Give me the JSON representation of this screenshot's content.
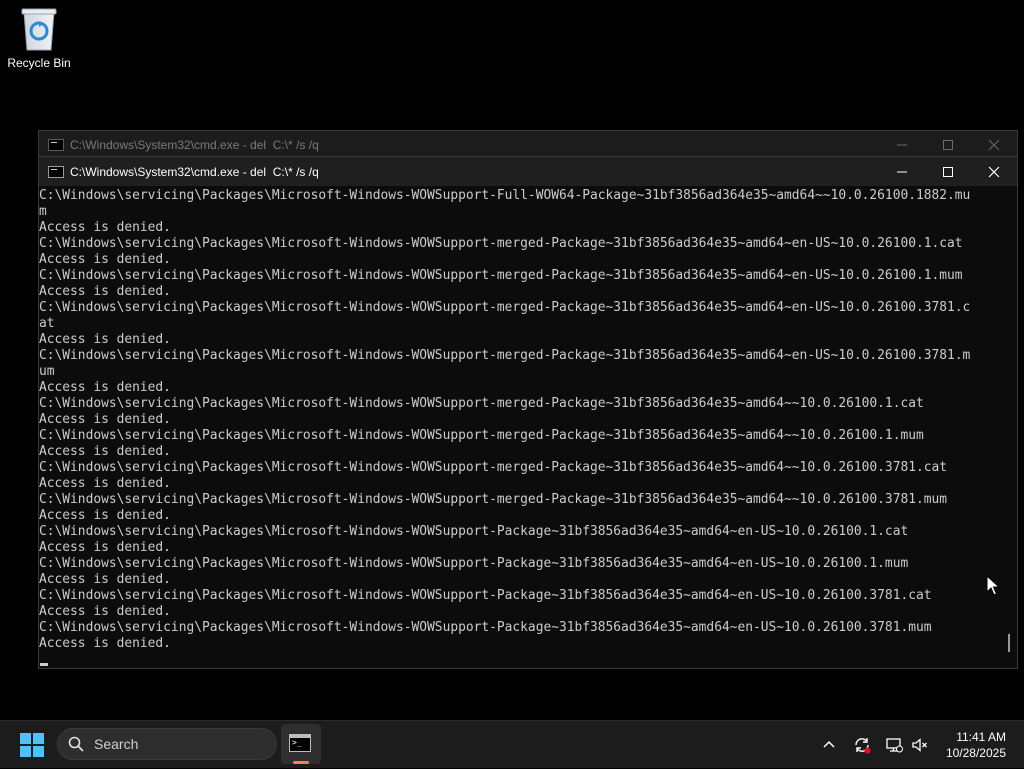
{
  "desktop": {
    "recycle_bin_label": "Recycle Bin"
  },
  "window_back": {
    "title": "C:\\Windows\\System32\\cmd.exe - del  C:\\* /s /q"
  },
  "window_front": {
    "title": "C:\\Windows\\System32\\cmd.exe - del  C:\\* /s /q",
    "console_lines": [
      "C:\\Windows\\servicing\\Packages\\Microsoft-Windows-WOWSupport-Full-WOW64-Package~31bf3856ad364e35~amd64~~10.0.26100.1882.mu",
      "m",
      "Access is denied.",
      "C:\\Windows\\servicing\\Packages\\Microsoft-Windows-WOWSupport-merged-Package~31bf3856ad364e35~amd64~en-US~10.0.26100.1.cat",
      "Access is denied.",
      "C:\\Windows\\servicing\\Packages\\Microsoft-Windows-WOWSupport-merged-Package~31bf3856ad364e35~amd64~en-US~10.0.26100.1.mum",
      "Access is denied.",
      "C:\\Windows\\servicing\\Packages\\Microsoft-Windows-WOWSupport-merged-Package~31bf3856ad364e35~amd64~en-US~10.0.26100.3781.c",
      "at",
      "Access is denied.",
      "C:\\Windows\\servicing\\Packages\\Microsoft-Windows-WOWSupport-merged-Package~31bf3856ad364e35~amd64~en-US~10.0.26100.3781.m",
      "um",
      "Access is denied.",
      "C:\\Windows\\servicing\\Packages\\Microsoft-Windows-WOWSupport-merged-Package~31bf3856ad364e35~amd64~~10.0.26100.1.cat",
      "Access is denied.",
      "C:\\Windows\\servicing\\Packages\\Microsoft-Windows-WOWSupport-merged-Package~31bf3856ad364e35~amd64~~10.0.26100.1.mum",
      "Access is denied.",
      "C:\\Windows\\servicing\\Packages\\Microsoft-Windows-WOWSupport-merged-Package~31bf3856ad364e35~amd64~~10.0.26100.3781.cat",
      "Access is denied.",
      "C:\\Windows\\servicing\\Packages\\Microsoft-Windows-WOWSupport-merged-Package~31bf3856ad364e35~amd64~~10.0.26100.3781.mum",
      "Access is denied.",
      "C:\\Windows\\servicing\\Packages\\Microsoft-Windows-WOWSupport-Package~31bf3856ad364e35~amd64~en-US~10.0.26100.1.cat",
      "Access is denied.",
      "C:\\Windows\\servicing\\Packages\\Microsoft-Windows-WOWSupport-Package~31bf3856ad364e35~amd64~en-US~10.0.26100.1.mum",
      "Access is denied.",
      "C:\\Windows\\servicing\\Packages\\Microsoft-Windows-WOWSupport-Package~31bf3856ad364e35~amd64~en-US~10.0.26100.3781.cat",
      "Access is denied.",
      "C:\\Windows\\servicing\\Packages\\Microsoft-Windows-WOWSupport-Package~31bf3856ad364e35~amd64~en-US~10.0.26100.3781.mum",
      "Access is denied."
    ]
  },
  "taskbar": {
    "search_placeholder": "Search",
    "time": "11:41 AM",
    "date": "10/28/2025"
  },
  "colors": {
    "console_bg": "#0c0c0c",
    "console_text": "#cccccc",
    "taskbar_bg": "#1c1c1c",
    "accent_windows": "#4cc2ff",
    "app_indicator": "#ff7b5e"
  }
}
